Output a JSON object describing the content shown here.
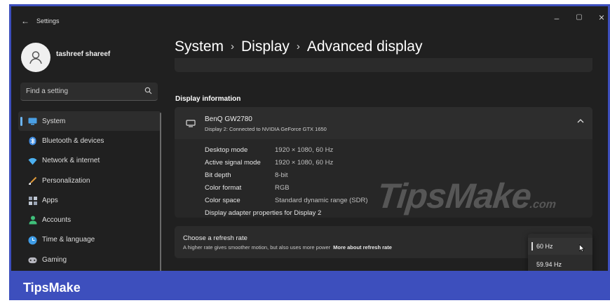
{
  "window": {
    "back_label": "←",
    "title": "Settings",
    "minimize": "–",
    "maximize": "▢",
    "close": "✕"
  },
  "user": {
    "name": "tashreef shareef"
  },
  "search": {
    "placeholder": "Find a setting"
  },
  "sidebar": {
    "items": [
      {
        "label": "System",
        "icon": "system-icon",
        "color": "#4aa0e6"
      },
      {
        "label": "Bluetooth & devices",
        "icon": "bluetooth-icon",
        "color": "#3f8ce0"
      },
      {
        "label": "Network & internet",
        "icon": "wifi-icon",
        "color": "#4cb0f0"
      },
      {
        "label": "Personalization",
        "icon": "brush-icon",
        "color": "#e09a3a"
      },
      {
        "label": "Apps",
        "icon": "apps-icon",
        "color": "#9aa4b4"
      },
      {
        "label": "Accounts",
        "icon": "person-icon",
        "color": "#3fbf7a"
      },
      {
        "label": "Time & language",
        "icon": "globe-clock-icon",
        "color": "#3f9ce6"
      },
      {
        "label": "Gaming",
        "icon": "gamepad-icon",
        "color": "#b8b8c0"
      }
    ]
  },
  "breadcrumb": {
    "part1": "System",
    "sep1": "›",
    "part2": "Display",
    "sep2": "›",
    "part3": "Advanced display"
  },
  "display_info": {
    "heading": "Display information",
    "monitor_name": "BenQ GW2780",
    "monitor_sub": "Display 2: Connected to NVIDIA GeForce GTX 1650",
    "rows": [
      {
        "key": "Desktop mode",
        "value": "1920 × 1080, 60 Hz"
      },
      {
        "key": "Active signal mode",
        "value": "1920 × 1080, 60 Hz"
      },
      {
        "key": "Bit depth",
        "value": "8-bit"
      },
      {
        "key": "Color format",
        "value": "RGB"
      },
      {
        "key": "Color space",
        "value": "Standard dynamic range (SDR)"
      }
    ],
    "adapter_link": "Display adapter properties for Display 2"
  },
  "refresh": {
    "title": "Choose a refresh rate",
    "subtitle": "A higher rate gives smoother motion, but also uses more power",
    "link": "More about refresh rate",
    "options": [
      "60 Hz",
      "59.94 Hz"
    ],
    "selected": "60 Hz"
  },
  "watermark": {
    "text": "TipsMake",
    "suffix": ".com"
  },
  "banner": {
    "text": "TipsMake",
    "color": "#3d4fbd"
  }
}
